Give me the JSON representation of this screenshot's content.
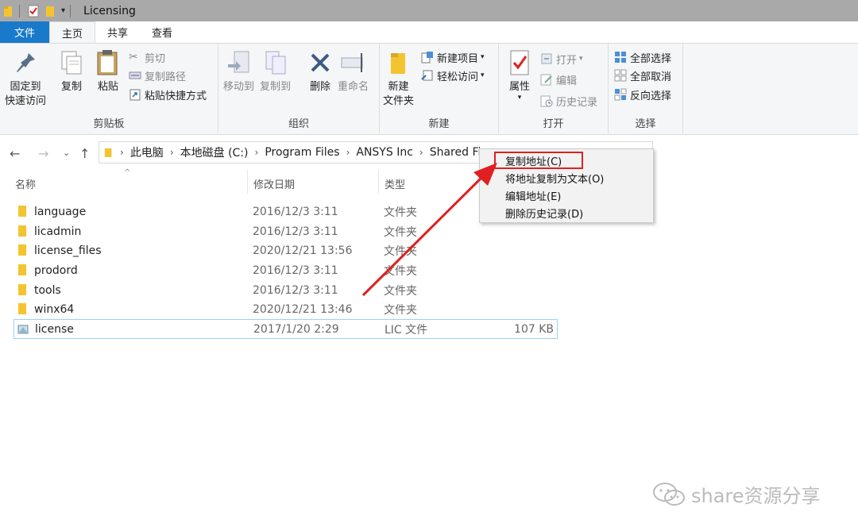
{
  "window": {
    "title": "Licensing"
  },
  "tabs": {
    "file": "文件",
    "home": "主页",
    "share": "共享",
    "view": "查看"
  },
  "ribbon": {
    "clipboard": {
      "label": "剪贴板",
      "pin_line1": "固定到",
      "pin_line2": "快速访问",
      "copy": "复制",
      "paste": "粘贴",
      "cut": "剪切",
      "copy_path": "复制路径",
      "paste_shortcut": "粘贴快捷方式"
    },
    "organize": {
      "label": "组织",
      "move_to": "移动到",
      "copy_to": "复制到",
      "delete": "删除",
      "rename": "重命名"
    },
    "new": {
      "label": "新建",
      "new_folder_line1": "新建",
      "new_folder_line2": "文件夹",
      "new_item": "新建项目",
      "easy_access": "轻松访问"
    },
    "open": {
      "label": "打开",
      "properties": "属性",
      "open": "打开",
      "edit": "编辑",
      "history": "历史记录"
    },
    "select": {
      "label": "选择",
      "select_all": "全部选择",
      "select_none": "全部取消",
      "invert": "反向选择"
    }
  },
  "address": {
    "crumbs": [
      "此电脑",
      "本地磁盘 (C:)",
      "Program Files",
      "ANSYS Inc",
      "Shared Fi"
    ]
  },
  "columns": {
    "name": "名称",
    "date": "修改日期",
    "type": "类型"
  },
  "files": [
    {
      "name": "language",
      "date": "2016/12/3 3:11",
      "type": "文件夹",
      "size": ""
    },
    {
      "name": "licadmin",
      "date": "2016/12/3 3:11",
      "type": "文件夹",
      "size": ""
    },
    {
      "name": "license_files",
      "date": "2020/12/21 13:56",
      "type": "文件夹",
      "size": ""
    },
    {
      "name": "prodord",
      "date": "2016/12/3 3:11",
      "type": "文件夹",
      "size": ""
    },
    {
      "name": "tools",
      "date": "2016/12/3 3:11",
      "type": "文件夹",
      "size": ""
    },
    {
      "name": "winx64",
      "date": "2020/12/21 13:46",
      "type": "文件夹",
      "size": ""
    },
    {
      "name": "license",
      "date": "2017/1/20 2:29",
      "type": "LIC 文件",
      "size": "107 KB"
    }
  ],
  "context_menu": {
    "items": [
      "复制地址(C)",
      "将地址复制为文本(O)",
      "编辑地址(E)",
      "删除历史记录(D)"
    ]
  },
  "watermark": {
    "text": "share资源分享"
  },
  "colors": {
    "file_tab": "#1979ca",
    "highlight_box": "#e02020",
    "arrow": "#e02020",
    "folder": "#f4c430"
  }
}
